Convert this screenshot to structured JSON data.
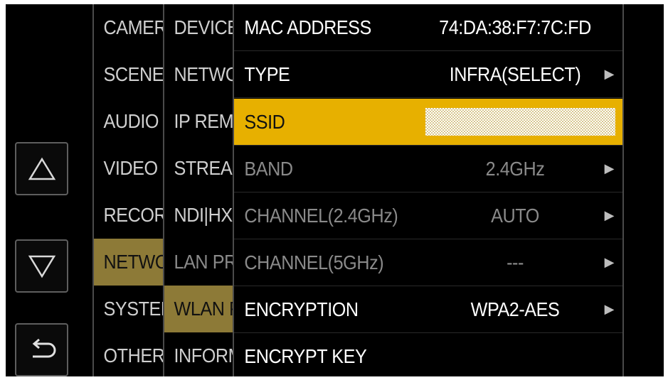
{
  "nav": {
    "up": "up-triangle-icon",
    "down": "down-triangle-icon",
    "back": "return-arrow-icon"
  },
  "menu_l1": {
    "items": [
      {
        "label": "CAMERA"
      },
      {
        "label": "SCENE"
      },
      {
        "label": "AUDIO"
      },
      {
        "label": "VIDEO OUT"
      },
      {
        "label": "RECORDING"
      },
      {
        "label": "NETWORK",
        "selected": true
      },
      {
        "label": "SYSTEM"
      },
      {
        "label": "OTHERS"
      }
    ]
  },
  "menu_l2": {
    "items": [
      {
        "label": "DEVICE SEL"
      },
      {
        "label": "NETWORK FUNC"
      },
      {
        "label": "IP REMOTE"
      },
      {
        "label": "STREAMING"
      },
      {
        "label": "NDI|HX"
      },
      {
        "label": "LAN PROPERTY"
      },
      {
        "label": "WLAN PROPERTY",
        "selected": true
      },
      {
        "label": "INFORMATION"
      }
    ]
  },
  "wlan": {
    "rows": [
      {
        "label": "MAC ADDRESS",
        "value": "74:DA:38:F7:7C:FD",
        "arrow": ""
      },
      {
        "label": "TYPE",
        "value": "INFRA(SELECT)",
        "arrow": "▶"
      },
      {
        "label": "SSID",
        "value": "",
        "arrow": ""
      },
      {
        "label": "BAND",
        "value": "2.4GHz",
        "arrow": "▶"
      },
      {
        "label": "CHANNEL(2.4GHz)",
        "value": "AUTO",
        "arrow": "▶"
      },
      {
        "label": "CHANNEL(5GHz)",
        "value": "---",
        "arrow": "▶"
      },
      {
        "label": "ENCRYPTION",
        "value": "WPA2-AES",
        "arrow": "▶"
      },
      {
        "label": "ENCRYPT KEY",
        "value": "",
        "arrow": ""
      }
    ]
  },
  "colors": {
    "selected_row": "#e7b000",
    "parent_selected": "#8d7a37",
    "background": "#000000"
  }
}
